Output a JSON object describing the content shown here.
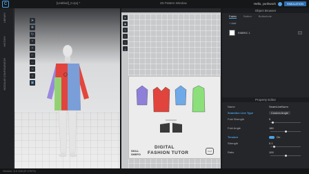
{
  "app": {
    "logo_glyph": "C",
    "doc_title": "[Untitled]_0.zprj *",
    "window_2d_title": "2D Pattern Window",
    "user_name": "Hello, yunhwork",
    "simulation_label": "SIMULATION"
  },
  "left_strip": {
    "labels": [
      "LIBRARY",
      "HISTORY",
      "MODULAR CONFIGURATOR"
    ]
  },
  "toolbar_3d": {
    "icons": [
      "select-icon",
      "move-icon",
      "rotate-icon",
      "pin-icon",
      "tack-icon",
      "fold-icon",
      "measure-icon",
      "avatar-icon",
      "light-icon",
      "camera-icon"
    ]
  },
  "toolbar_2d": {
    "icons": [
      "transform-icon",
      "edit-point-icon",
      "curve-icon",
      "rect-icon",
      "circle-icon",
      "sew-icon"
    ]
  },
  "right_panel": {
    "object_browser_title": "Object Browser",
    "tabs": [
      "Fabric",
      "Button",
      "Buttonhole"
    ],
    "add_label": "+ Add",
    "fabric_name": "FABRIC 1",
    "property_editor_title": "Property Editor",
    "properties": [
      {
        "label": "Name",
        "value": "SeamLineNorm",
        "type": "text"
      },
      {
        "label": "Seamline Line Type",
        "value": "Custom Angle",
        "type": "select",
        "section": true
      },
      {
        "label": "Fold Strength",
        "value": "5",
        "type": "slider",
        "level": 0.05
      },
      {
        "label": "Fold Angle",
        "value": "180",
        "type": "slider",
        "level": 0.5
      },
      {
        "label": "Tension",
        "value": "On",
        "type": "toggle",
        "section": true
      },
      {
        "label": "Strength",
        "value": "0.1",
        "type": "slider",
        "level": 0.1
      },
      {
        "label": "Ratio",
        "value": "100",
        "type": "slider",
        "level": 0.5
      }
    ]
  },
  "watermark": {
    "brand_line1": "SKILL",
    "brand_line2": "SHEPO",
    "title_line1": "DIGITAL",
    "title_line2": "FASHION TUTOR",
    "stamp": "CLO"
  },
  "status_bar": {
    "version": "Version: 6.0.328 (R 47879)"
  },
  "colors": {
    "purple": "#8e7fd9",
    "red": "#e0443c",
    "blue": "#6fa9e8",
    "green": "#8be07a",
    "accent": "#4aa3e8"
  }
}
